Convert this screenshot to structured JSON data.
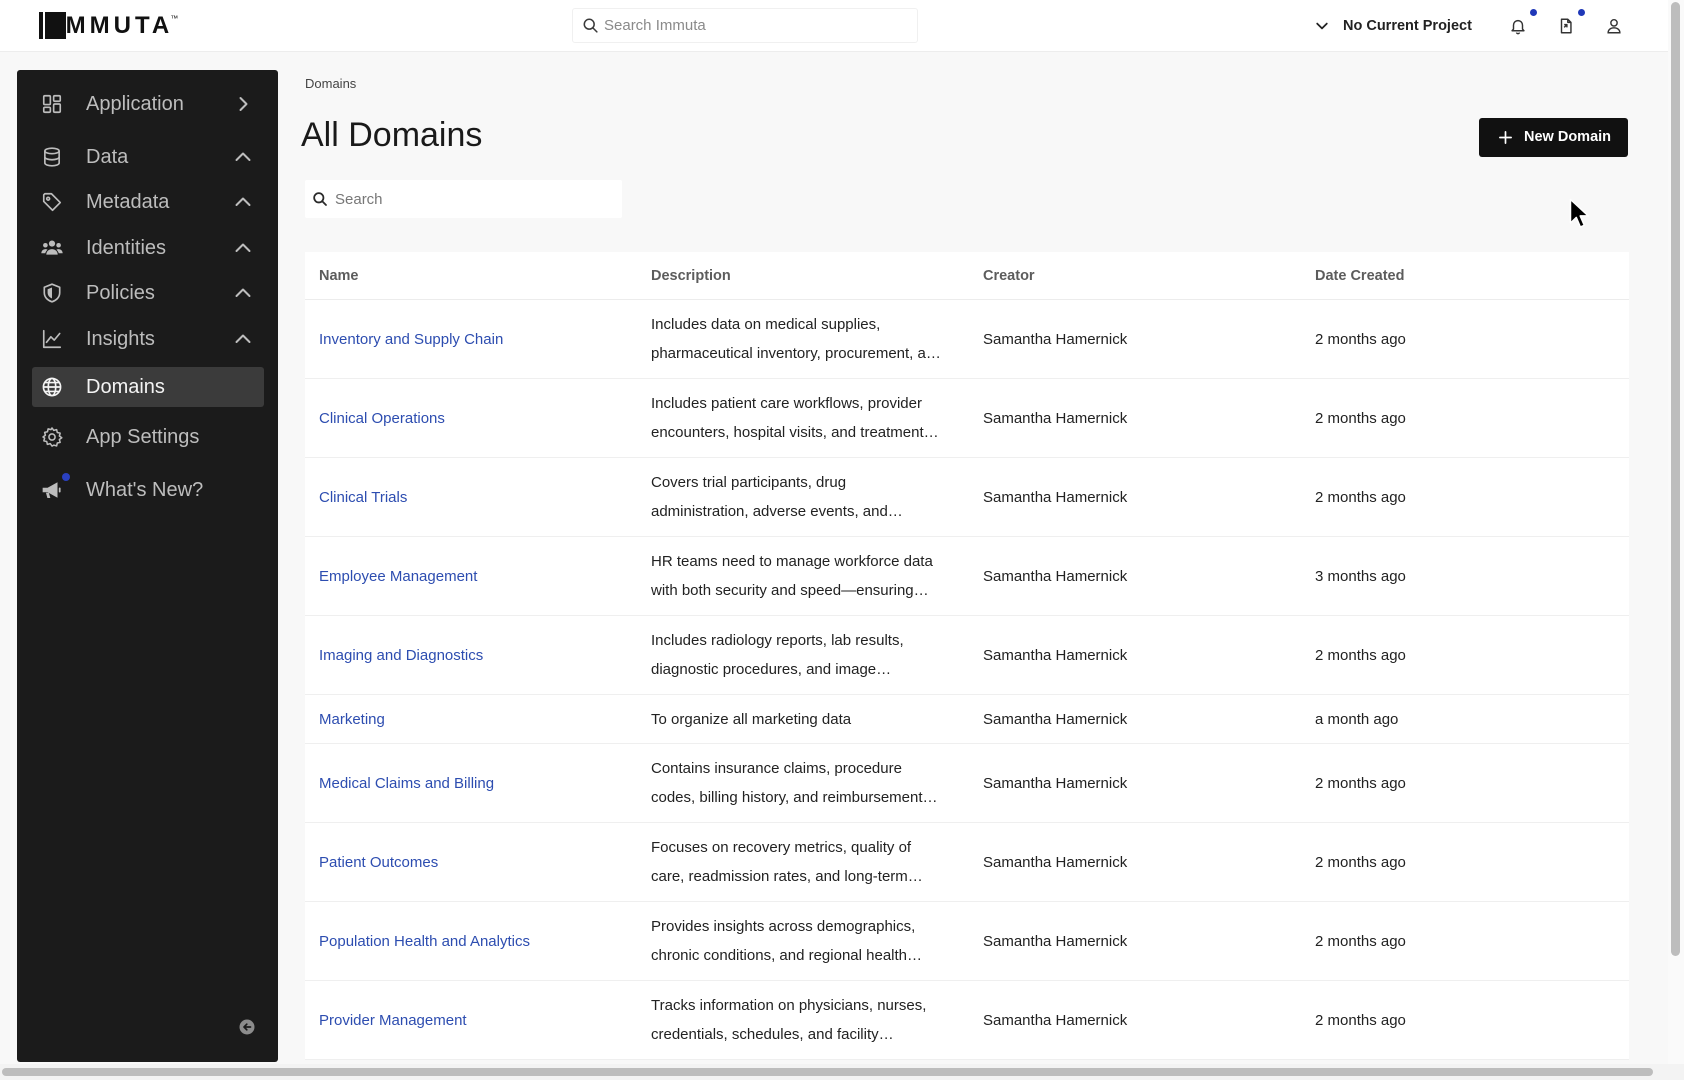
{
  "brand": {
    "logo_text": "IMMUTA",
    "trademark": "™"
  },
  "topbar": {
    "search_placeholder": "Search Immuta",
    "search_icon": "search-icon",
    "project_selector": {
      "label": "No Current Project",
      "icon": "chevron-down-icon"
    },
    "notifications": {
      "icon": "bell-icon",
      "has_unread": true
    },
    "requests": {
      "icon": "document-icon",
      "has_unread": true
    },
    "account": {
      "icon": "user-icon"
    }
  },
  "sidebar": {
    "items": [
      {
        "label": "Application",
        "icon": "dashboard-icon",
        "chevron_icon": "chevron-right-icon"
      },
      {
        "label": "Data",
        "icon": "database-icon",
        "chevron_icon": "chevron-up-icon"
      },
      {
        "label": "Metadata",
        "icon": "tag-icon",
        "chevron_icon": "chevron-up-icon"
      },
      {
        "label": "Identities",
        "icon": "users-icon",
        "chevron_icon": "chevron-up-icon"
      },
      {
        "label": "Policies",
        "icon": "shield-icon",
        "chevron_icon": "chevron-up-icon"
      },
      {
        "label": "Insights",
        "icon": "chart-line-icon",
        "chevron_icon": "chevron-up-icon"
      },
      {
        "label": "Domains",
        "icon": "globe-icon",
        "active": true
      },
      {
        "label": "App Settings",
        "icon": "gear-icon"
      },
      {
        "label": "What's New?",
        "icon": "megaphone-icon",
        "has_unread": true
      }
    ],
    "collapse_icon": "collapse-sidebar-icon"
  },
  "breadcrumb": {
    "items": [
      "Domains"
    ]
  },
  "page": {
    "title": "All Domains",
    "new_button_label": "New Domain",
    "new_button_icon": "plus-icon",
    "search_placeholder": "Search"
  },
  "table": {
    "columns": [
      "Name",
      "Description",
      "Creator",
      "Date Created"
    ],
    "rows": [
      {
        "name": "Inventory and Supply Chain",
        "description_lines": [
          "Includes data on medical supplies,",
          "pharmaceutical inventory, procurement, a…"
        ],
        "creator": "Samantha Hamernick",
        "date_created": "2 months ago"
      },
      {
        "name": "Clinical Operations",
        "description_lines": [
          "Includes patient care workflows, provider",
          "encounters, hospital visits, and treatment…"
        ],
        "creator": "Samantha Hamernick",
        "date_created": "2 months ago"
      },
      {
        "name": "Clinical Trials",
        "description_lines": [
          "Covers trial participants, drug",
          "administration, adverse events, and…"
        ],
        "creator": "Samantha Hamernick",
        "date_created": "2 months ago"
      },
      {
        "name": "Employee Management",
        "description_lines": [
          "HR teams need to manage workforce data",
          "with both security and speed—ensuring…"
        ],
        "creator": "Samantha Hamernick",
        "date_created": "3 months ago"
      },
      {
        "name": "Imaging and Diagnostics",
        "description_lines": [
          "Includes radiology reports, lab results,",
          "diagnostic procedures, and image…"
        ],
        "creator": "Samantha Hamernick",
        "date_created": "2 months ago"
      },
      {
        "name": "Marketing",
        "description_lines": [
          "To organize all marketing data"
        ],
        "creator": "Samantha Hamernick",
        "date_created": "a month ago"
      },
      {
        "name": "Medical Claims and Billing",
        "description_lines": [
          "Contains insurance claims, procedure",
          "codes, billing history, and reimbursement…"
        ],
        "creator": "Samantha Hamernick",
        "date_created": "2 months ago"
      },
      {
        "name": "Patient Outcomes",
        "description_lines": [
          "Focuses on recovery metrics, quality of",
          "care, readmission rates, and long-term…"
        ],
        "creator": "Samantha Hamernick",
        "date_created": "2 months ago"
      },
      {
        "name": "Population Health and Analytics",
        "description_lines": [
          "Provides insights across demographics,",
          "chronic conditions, and regional health…"
        ],
        "creator": "Samantha Hamernick",
        "date_created": "2 months ago"
      },
      {
        "name": "Provider Management",
        "description_lines": [
          "Tracks information on physicians, nurses,",
          "credentials, schedules, and facility…"
        ],
        "creator": "Samantha Hamernick",
        "date_created": "2 months ago"
      }
    ]
  },
  "colors": {
    "link": "#2d4db0",
    "notification_dot": "#1f38b8",
    "primary_button": "#111111",
    "sidebar_background": "#1b1b1b",
    "sidebar_active": "#3b3b3b"
  }
}
